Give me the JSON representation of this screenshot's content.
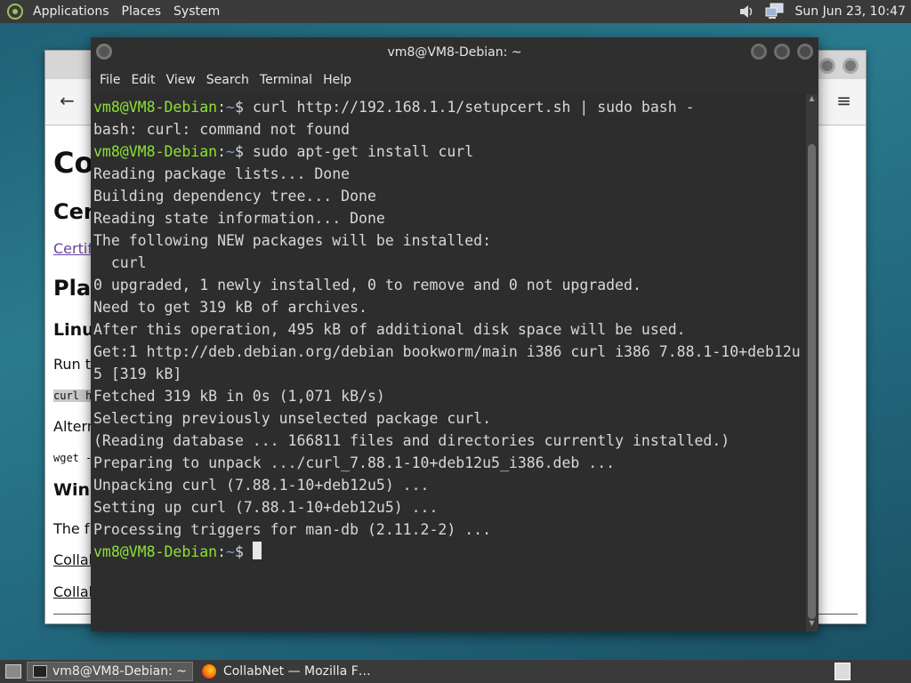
{
  "top_panel": {
    "menus": [
      "Applications",
      "Places",
      "System"
    ],
    "clock": "Sun Jun 23, 10:47"
  },
  "browser": {
    "content": {
      "h1": "Co",
      "h2": "Cer",
      "link1": "Certif",
      "h2b": "Pla",
      "h3a": "Linu",
      "p1": "Run t",
      "code1": "curl h",
      "p2": "Altern",
      "code2": "wget -",
      "h3b": "Win",
      "p3": "The f",
      "link2": "Collab",
      "link3": "Collab"
    }
  },
  "terminal": {
    "title": "vm8@VM8-Debian: ~",
    "menu": [
      "File",
      "Edit",
      "View",
      "Search",
      "Terminal",
      "Help"
    ],
    "prompt_user": "vm8@VM8-Debian",
    "prompt_sep": ":",
    "prompt_path": "~",
    "prompt_sym": "$ ",
    "cmd1": "curl http://192.168.1.1/setupcert.sh | sudo bash -",
    "cmd2": "sudo apt-get install curl",
    "output1": [
      "bash: curl: command not found"
    ],
    "output2": [
      "Reading package lists... Done",
      "Building dependency tree... Done",
      "Reading state information... Done",
      "The following NEW packages will be installed:",
      "  curl",
      "0 upgraded, 1 newly installed, 0 to remove and 0 not upgraded.",
      "Need to get 319 kB of archives.",
      "After this operation, 495 kB of additional disk space will be used.",
      "Get:1 http://deb.debian.org/debian bookworm/main i386 curl i386 7.88.1-10+deb12u",
      "5 [319 kB]",
      "Fetched 319 kB in 0s (1,071 kB/s)",
      "Selecting previously unselected package curl.",
      "(Reading database ... 166811 files and directories currently installed.)",
      "Preparing to unpack .../curl_7.88.1-10+deb12u5_i386.deb ...",
      "Unpacking curl (7.88.1-10+deb12u5) ...",
      "Setting up curl (7.88.1-10+deb12u5) ...",
      "Processing triggers for man-db (2.11.2-2) ..."
    ]
  },
  "taskbar": {
    "tasks": [
      "vm8@VM8-Debian: ~",
      "CollabNet — Mozilla F…"
    ]
  },
  "icons": {
    "desktop": "show-desktop-icon",
    "volume": "volume-icon",
    "network": "network-icon",
    "firefox": "firefox-icon",
    "terminal": "terminal-icon"
  }
}
